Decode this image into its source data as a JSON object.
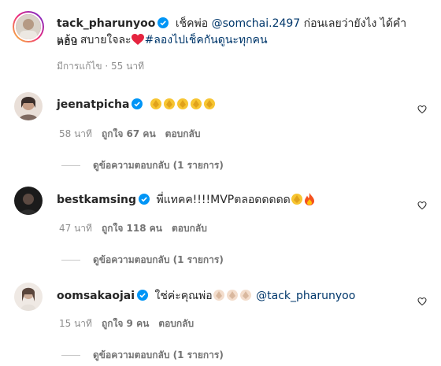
{
  "caption": {
    "username": "tack_pharunyoo",
    "text_before": "เช็คพ่อ ",
    "mention": "@somchai.2497",
    "text_after_line1": " ก่อนเลยว่ายังไง ได้คำตอบ",
    "text_line2": "แล้ว สบายใจละ",
    "hashtag": "#ลองไปเช็คกันดูนะทุกคน",
    "meta": "มีการแก้ไข · 55 นาที"
  },
  "comments": [
    {
      "username": "jeenatpicha",
      "text": "",
      "emojis": [
        "clap",
        "clap",
        "clap",
        "clap",
        "clap"
      ],
      "time": "58 นาที",
      "likes": "ถูกใจ 67 คน",
      "reply": "ตอบกลับ",
      "view_replies": "ดูข้อความตอบกลับ (1 รายการ)"
    },
    {
      "username": "bestkamsing",
      "text": "พี่แทคค!!!!MVPตลอดดดดด",
      "emojis": [
        "clap",
        "fire"
      ],
      "time": "47 นาที",
      "likes": "ถูกใจ 118 คน",
      "reply": "ตอบกลับ",
      "view_replies": "ดูข้อความตอบกลับ (1 รายการ)"
    },
    {
      "username": "oomsakaojai",
      "text": "ใช่ค่ะคุณพ่อ",
      "emojis": [
        "clap-light",
        "clap-light",
        "clap-light"
      ],
      "mention": "@tack_pharunyoo",
      "time": "15 นาที",
      "likes": "ถูกใจ 9 คน",
      "reply": "ตอบกลับ",
      "view_replies": "ดูข้อความตอบกลับ (1 รายการ)"
    }
  ],
  "colors": {
    "link": "#00376b",
    "verified": "#0095f6",
    "meta": "#8e8e8e"
  },
  "icons": {
    "verified": "verified-badge-icon",
    "like": "heart-icon",
    "heart_emoji": "red-heart-emoji"
  }
}
